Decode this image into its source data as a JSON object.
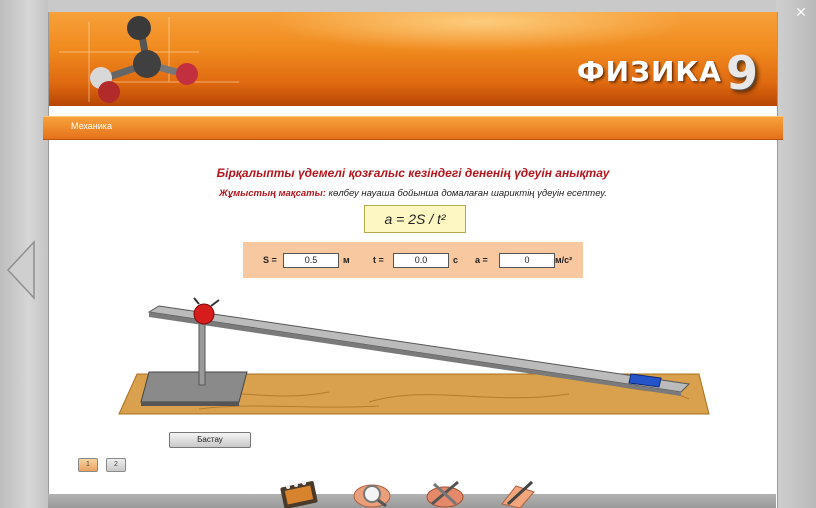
{
  "header": {
    "brand": "ФИЗИКА",
    "brand_number": "9"
  },
  "section": {
    "label": "Механика"
  },
  "lesson": {
    "title": "Бірқалыпты үдемелі  қозғалыс кезіндегі дененің үдеуін анықтау",
    "goal_label": "Жұмыстың мақсаты:",
    "goal_text": " көлбеу науаша бойынша домалаған шариктің үдеуін есептеу.",
    "formula": "a = 2S / t²"
  },
  "params": {
    "s_label": "S =",
    "s_value": "0.5",
    "s_unit": "м",
    "t_label": "t =",
    "t_value": "0.0",
    "t_unit": "с",
    "a_label": "a =",
    "a_value": "0",
    "a_unit": "м/с²"
  },
  "controls": {
    "start_label": "Бастау",
    "page1_label": "1",
    "page2_label": "2"
  },
  "window": {
    "close_label": "✕"
  },
  "icons": [
    "molecule-logo-icon",
    "nav-left-arrow-icon",
    "film-icon",
    "magnifier-icon",
    "tools-icon",
    "pen-icon"
  ],
  "colors": {
    "accent": "#f08a1e",
    "title_red": "#b3161c",
    "formula_bg": "#fdf7c4",
    "params_bg": "#f8c8a0"
  }
}
